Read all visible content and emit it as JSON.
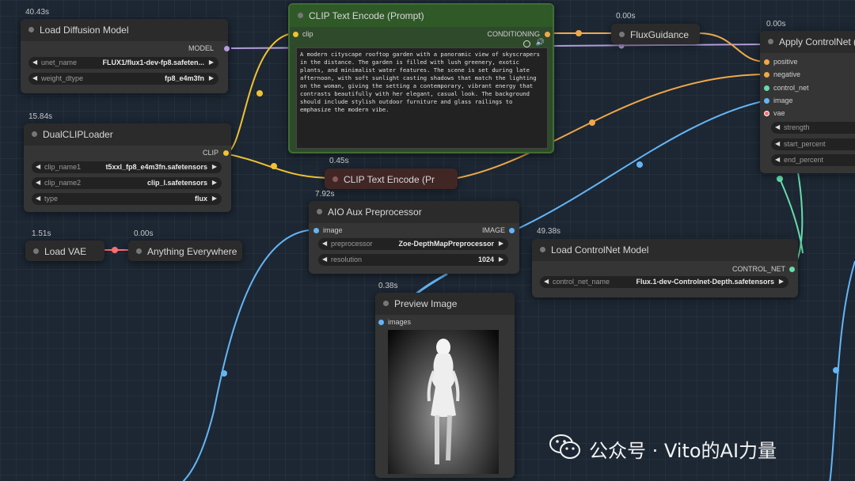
{
  "nodes": {
    "load_diffusion": {
      "title": "Load Diffusion Model",
      "timer": "40.43s",
      "output": "MODEL",
      "widgets": [
        {
          "label": "unet_name",
          "value": "FLUX1/flux1-dev-fp8.safeten..."
        },
        {
          "label": "weight_dtype",
          "value": "fp8_e4m3fn"
        }
      ]
    },
    "dual_clip": {
      "title": "DualCLIPLoader",
      "timer": "15.84s",
      "output": "CLIP",
      "widgets": [
        {
          "label": "clip_name1",
          "value": "t5xxl_fp8_e4m3fn.safetensors"
        },
        {
          "label": "clip_name2",
          "value": "clip_l.safetensors"
        },
        {
          "label": "type",
          "value": "flux"
        }
      ]
    },
    "load_vae": {
      "title": "Load VAE",
      "timer": "1.51s"
    },
    "anything_everywhere": {
      "title": "Anything Everywhere",
      "timer": "0.00s"
    },
    "clip_text_prompt": {
      "title": "CLIP Text Encode (Prompt)",
      "input": "clip",
      "output": "CONDITIONING",
      "text": "A modern cityscape rooftop garden with a panoramic view of skyscrapers in the distance. The garden is filled with lush greenery, exotic plants, and minimalist water features. The scene is set during late afternoon, with soft sunlight casting shadows that match the lighting on the woman, giving the setting a contemporary, vibrant energy that contrasts beautifully with her elegant, casual look. The background should include stylish outdoor furniture and glass railings to emphasize the modern vibe."
    },
    "clip_text_collapsed": {
      "title": "CLIP Text Encode (Pr",
      "timer": "0.45s"
    },
    "flux_guidance": {
      "title": "FluxGuidance",
      "timer": "0.00s"
    },
    "apply_controlnet": {
      "title": "Apply ControlNet (",
      "timer": "0.00s",
      "inputs": [
        "positive",
        "negative",
        "control_net",
        "image",
        "vae"
      ],
      "widgets": [
        {
          "label": "strength",
          "value": ""
        },
        {
          "label": "start_percent",
          "value": ""
        },
        {
          "label": "end_percent",
          "value": ""
        }
      ]
    },
    "aio_aux": {
      "title": "AIO Aux Preprocessor",
      "timer": "7.92s",
      "input": "image",
      "output": "IMAGE",
      "widgets": [
        {
          "label": "preprocessor",
          "value": "Zoe-DepthMapPreprocessor"
        },
        {
          "label": "resolution",
          "value": "1024"
        }
      ]
    },
    "load_controlnet": {
      "title": "Load ControlNet Model",
      "timer": "49.38s",
      "output": "CONTROL_NET",
      "widgets": [
        {
          "label": "control_net_name",
          "value": "Flux.1-dev-Controlnet-Depth.safetensors"
        }
      ]
    },
    "preview_image": {
      "title": "Preview Image",
      "timer": "0.38s",
      "input": "images"
    }
  },
  "watermark": "公众号 · Vito的AI力量",
  "colors": {
    "canvas": "#1c2733",
    "wire_clip": "#f1c232",
    "wire_conditioning": "#f0a848",
    "wire_model": "#b39ddb",
    "wire_image": "#64b5f6",
    "wire_controlnet": "#66ddaa",
    "wire_vae": "#ff6e6e",
    "prompt_node_border": "#3f6e34"
  }
}
